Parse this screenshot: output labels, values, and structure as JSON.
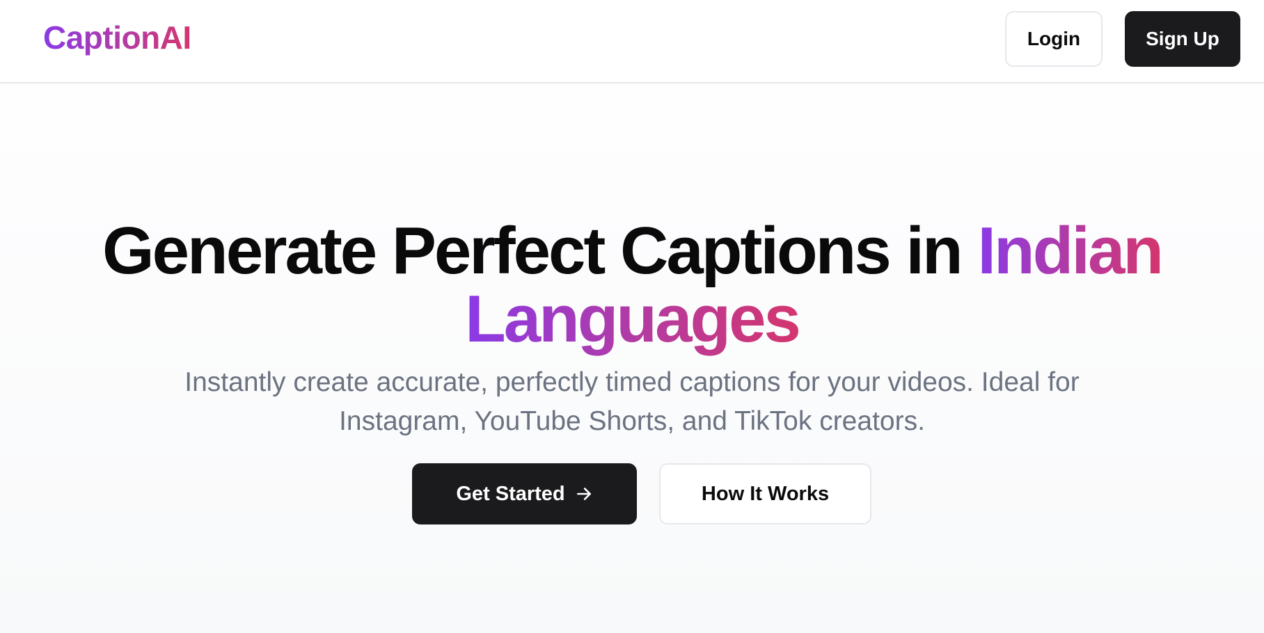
{
  "header": {
    "logo": "CaptionAI",
    "login_label": "Login",
    "signup_label": "Sign Up"
  },
  "hero": {
    "title_part1": "Generate Perfect Captions in",
    "title_highlight_1": "Indian",
    "title_highlight_2": "Languages",
    "subtitle_line1": "Instantly create accurate, perfectly timed captions for your videos. Ideal for",
    "subtitle_line2": "Instagram, YouTube Shorts, and TikTok creators.",
    "primary_cta": "Get Started",
    "secondary_cta": "How It Works"
  },
  "colors": {
    "gradient_start": "#8b3ae6",
    "gradient_mid": "#b23ba4",
    "gradient_end": "#d4366e",
    "primary_button": "#1b1b1d",
    "subtitle_text": "#6b7280"
  },
  "icons": {
    "cta_arrow": "arrow-right-icon"
  }
}
